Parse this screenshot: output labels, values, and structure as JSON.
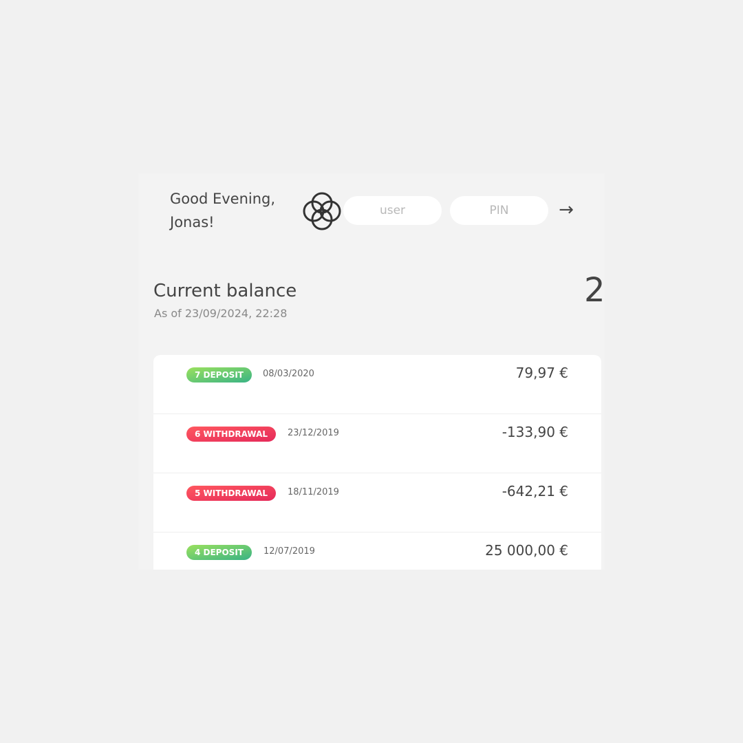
{
  "header": {
    "welcome_line1": "Good Evening,",
    "welcome_line2": "Jonas!",
    "logo_icon": "four-circles-logo-icon",
    "user_placeholder": "user",
    "pin_placeholder": "PIN",
    "login_button_label": "→"
  },
  "balance": {
    "label": "Current balance",
    "date_text": "As of 23/09/2024, 22:28",
    "value": "2"
  },
  "movements": [
    {
      "type_label": "7 DEPOSIT",
      "type": "deposit",
      "date": "08/03/2020",
      "value": "79,97 €"
    },
    {
      "type_label": "6 WITHDRAWAL",
      "type": "withdrawal",
      "date": "23/12/2019",
      "value": "-133,90 €"
    },
    {
      "type_label": "5 WITHDRAWAL",
      "type": "withdrawal",
      "date": "18/11/2019",
      "value": "-642,21 €"
    },
    {
      "type_label": "4 DEPOSIT",
      "type": "deposit",
      "date": "12/07/2019",
      "value": "25 000,00 €"
    }
  ],
  "colors": {
    "deposit": "#39b385",
    "withdrawal": "#e52a5a",
    "background": "#f1f1f1"
  }
}
